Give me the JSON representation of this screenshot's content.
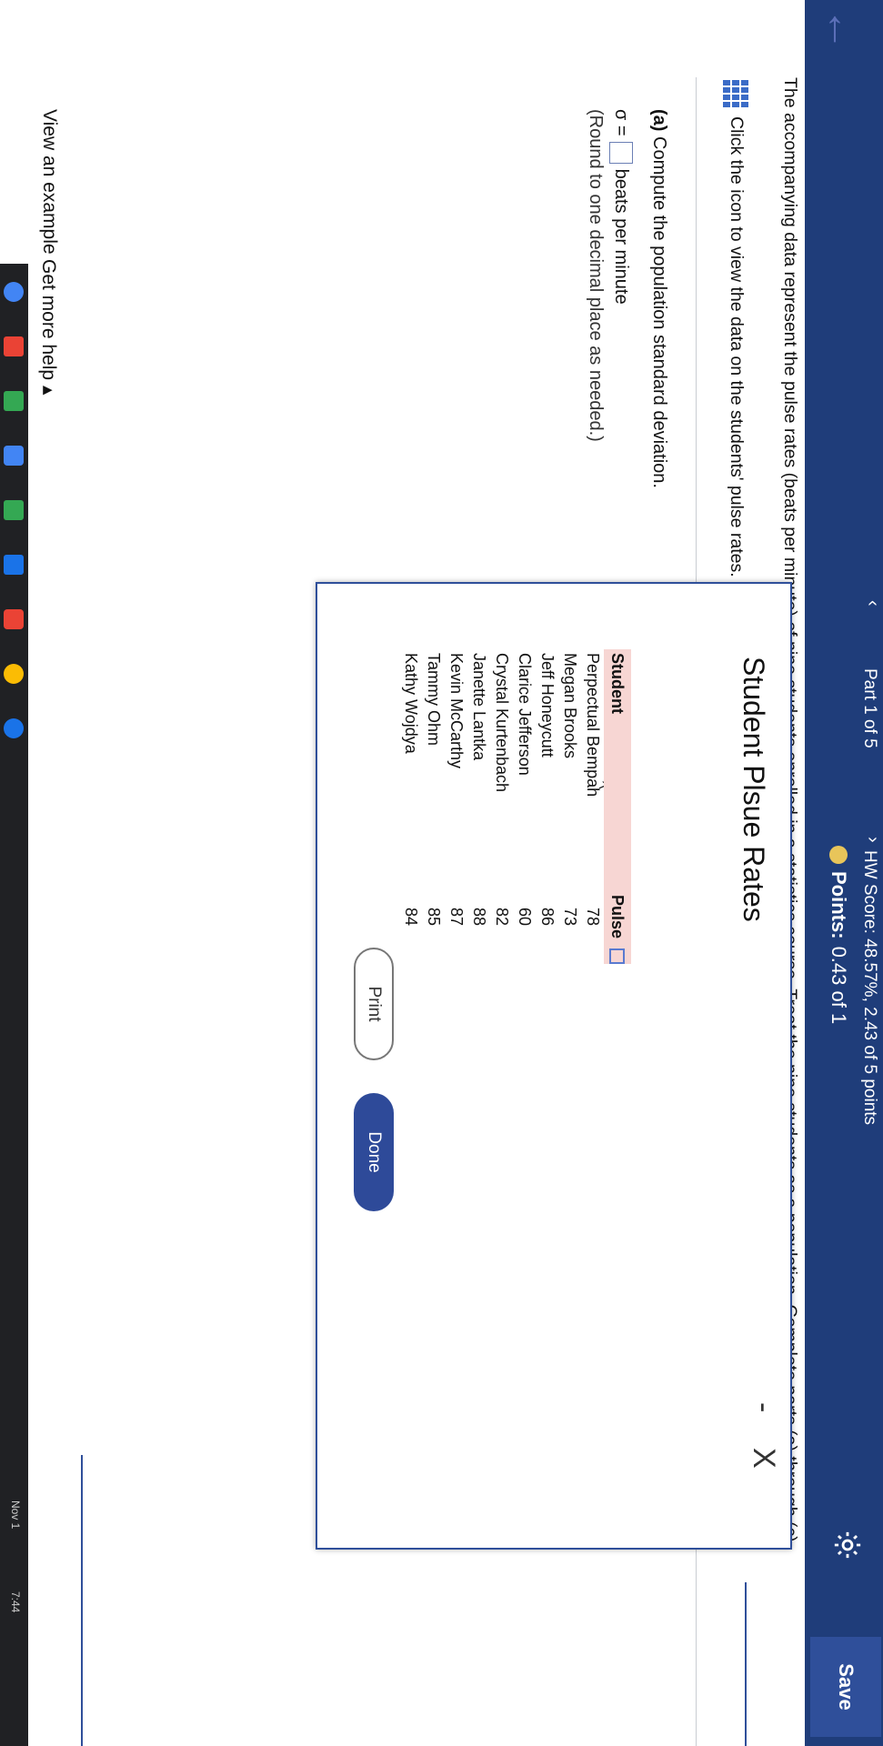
{
  "header": {
    "part": "Part 1 of 5",
    "hw_score": "HW Score: 48.57%, 2.43 of 5 points",
    "points_label": "Points:",
    "points_value": "0.43 of 1",
    "save": "Save",
    "back_icon": "back-arrow-icon",
    "settings_icon": "gear-icon"
  },
  "question": {
    "text": "The accompanying data represent the pulse rates (beats per minute) of nine students enrolled in a statistics course. Treat the nine students as a population. Complete parts (a) through (c).",
    "click": "Click the icon to view the data on the students' pulse rates.",
    "part_a_label": "(a)",
    "part_a_text": "Compute the population standard deviation.",
    "sigma": "σ =",
    "unit": "beats per minute",
    "round_note": "(Round to one decimal place as needed.)"
  },
  "popup": {
    "title": "Student Plsue Rates",
    "minimize": "-",
    "close": "X",
    "columns": [
      "Student",
      "Pulse"
    ],
    "rows": [
      {
        "name": "Perpectual Bempah",
        "pulse": "78"
      },
      {
        "name": "Megan Brooks",
        "pulse": "73"
      },
      {
        "name": "Jeff Honeycutt",
        "pulse": "86"
      },
      {
        "name": "Clarice Jefferson",
        "pulse": "60"
      },
      {
        "name": "Crystal Kurtenbach",
        "pulse": "82"
      },
      {
        "name": "Janette Lantka",
        "pulse": "88"
      },
      {
        "name": "Kevin McCarthy",
        "pulse": "87"
      },
      {
        "name": "Tammy Ohm",
        "pulse": "85"
      },
      {
        "name": "Kathy Wojdya",
        "pulse": "84"
      }
    ],
    "print": "Print",
    "done": "Done"
  },
  "footer": {
    "view_example": "View an example",
    "get_help": "Get more help ▴"
  },
  "taskbar": {
    "date": "Nov 1",
    "time": "7:44"
  }
}
